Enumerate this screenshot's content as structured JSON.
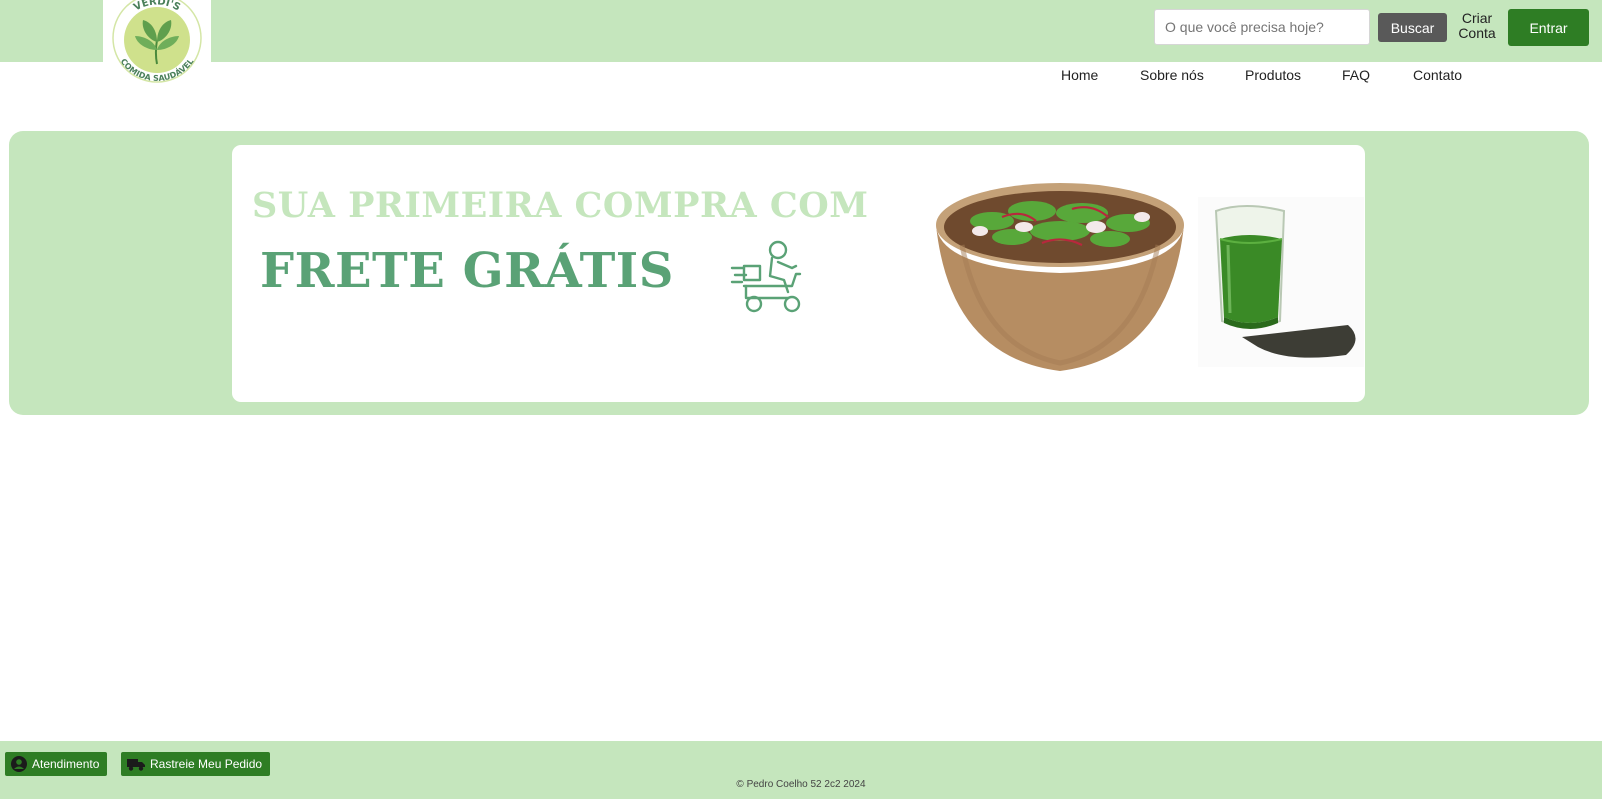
{
  "brand": {
    "logo_text_top": "VERDI'S",
    "logo_text_bottom": "COMIDA SAUDÁVEL",
    "colors": {
      "header_bg": "#c5e6bd",
      "primary_green": "#2e7d24",
      "banner_green": "#5aa276",
      "banner_light": "#c5e6bd",
      "search_button": "#595959"
    }
  },
  "header": {
    "search": {
      "placeholder": "O que você precisa hoje?",
      "value": ""
    },
    "search_button": "Buscar",
    "create_account": {
      "line1": "Criar",
      "line2": "Conta"
    },
    "login_button": "Entrar"
  },
  "nav": {
    "items": [
      {
        "label": "Home"
      },
      {
        "label": "Sobre nós"
      },
      {
        "label": "Produtos"
      },
      {
        "label": "FAQ"
      },
      {
        "label": "Contato"
      }
    ]
  },
  "banner": {
    "line1": "SUA PRIMEIRA COMPRA COM",
    "line2": "FRETE GRÁTIS",
    "icons": [
      "delivery-scooter-icon",
      "salad-bowl-image",
      "green-juice-image"
    ]
  },
  "footer": {
    "support_button": {
      "label": "Atendimento",
      "icon": "user-circle-icon"
    },
    "track_button": {
      "label": "Rastreie Meu Pedido",
      "icon": "truck-icon"
    },
    "copyright": "© Pedro Coelho 52 2c2 2024"
  }
}
